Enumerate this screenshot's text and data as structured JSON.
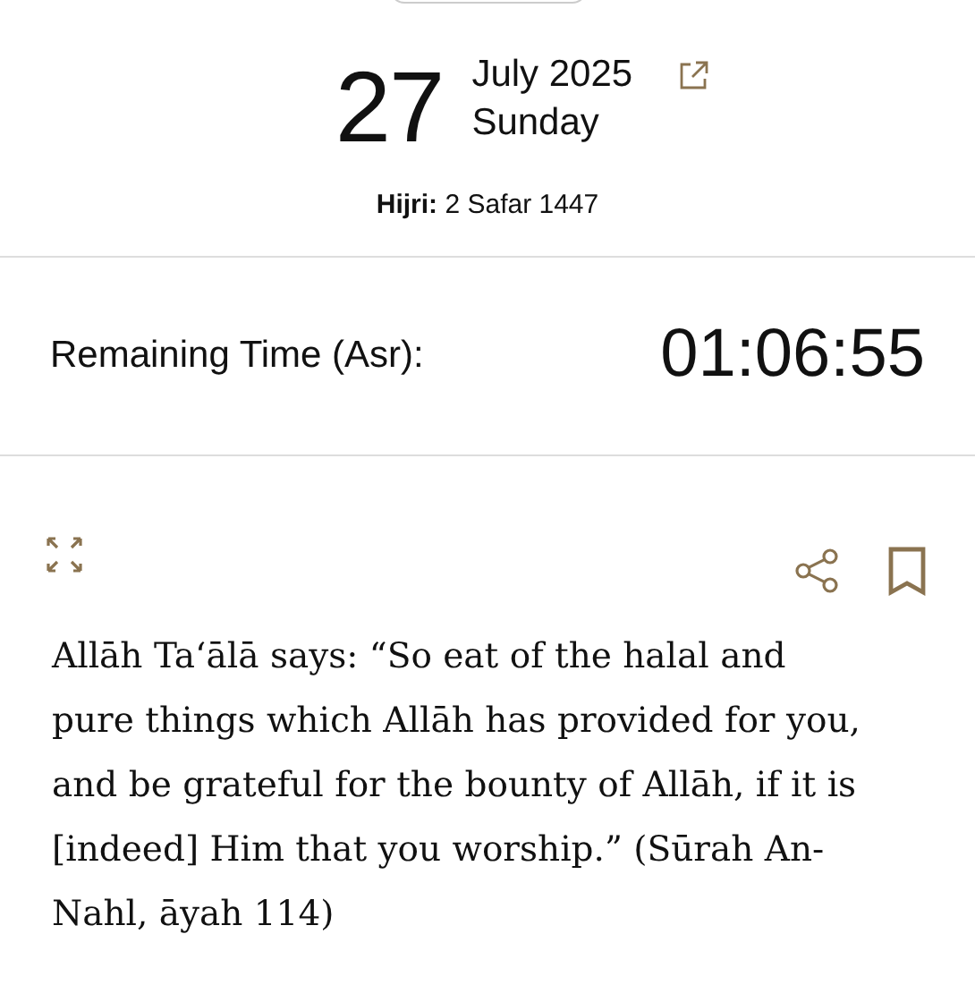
{
  "date": {
    "day": "27",
    "month_year": "July 2025",
    "weekday": "Sunday",
    "hijri_label": "Hijri:",
    "hijri_date": "2 Safar 1447"
  },
  "remaining": {
    "label": "Remaining Time (Asr):",
    "time": "01:06:55"
  },
  "quote": {
    "text": "Allāh Taʻālā says: “So eat of the halal and pure things which Allāh has provided for you, and be grateful for the bounty of Allāh, if it is [indeed] Him that you worship.” (Sūrah An-Nahl, āyah 114)"
  }
}
